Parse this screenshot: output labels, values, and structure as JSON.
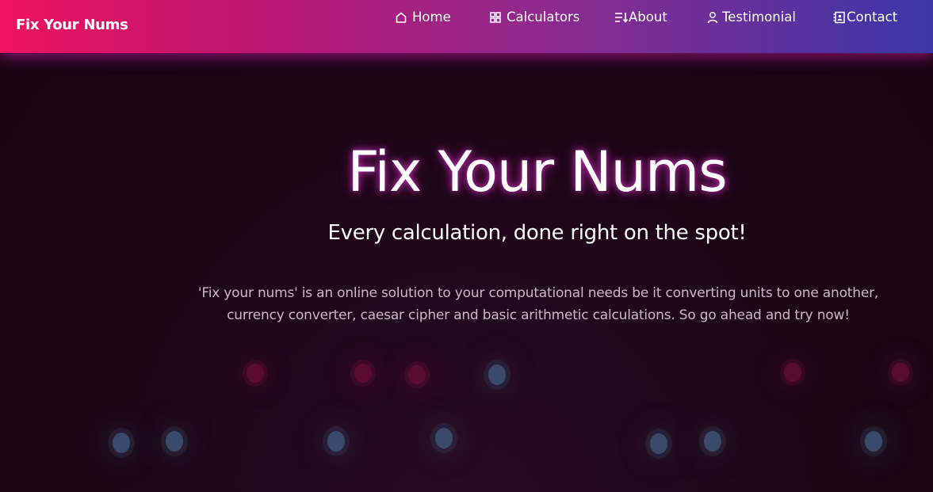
{
  "navbar": {
    "brand": "Fix Your Nums",
    "items": [
      {
        "label": "Home",
        "icon": "home-icon"
      },
      {
        "label": "Calculators",
        "icon": "grid-icon"
      },
      {
        "label": "About",
        "icon": "list-sort-icon"
      },
      {
        "label": "Testimonial",
        "icon": "user-icon"
      },
      {
        "label": "Contact",
        "icon": "contact-book-icon"
      }
    ]
  },
  "hero": {
    "title": "Fix Your Nums",
    "subtitle": "Every calculation, done right on the spot!",
    "description": "'Fix your nums' is an online solution to your computational needs be it converting units to one another, currency converter, caesar cipher and basic arithmetic calculations. So go ahead and try now!"
  },
  "colors": {
    "navbar_gradient_start": "#f0125f",
    "navbar_gradient_end": "#3a36a8",
    "background": "#1e0718",
    "title_glow": "#c82ab8",
    "bubble_blue": "#3a4a6a",
    "bubble_red": "#5a0c30"
  }
}
